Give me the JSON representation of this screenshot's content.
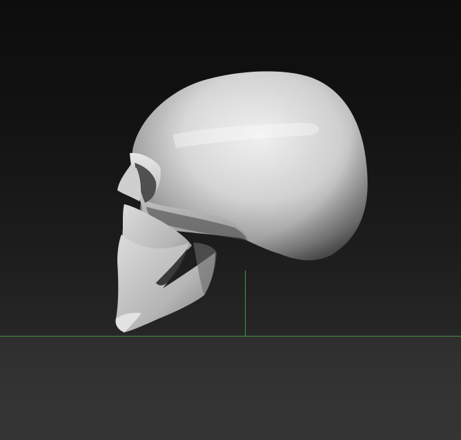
{
  "viewport": {
    "model": "skull-side-view",
    "colors": {
      "background_top": "#0d0d0d",
      "background_bottom": "#262626",
      "floor": "#333333",
      "horizon_line": "#3f8f3f",
      "axis_line": "#3f9f3f",
      "model_highlight": "#f2f2f2",
      "model_shadow": "#4a4a4a"
    }
  }
}
